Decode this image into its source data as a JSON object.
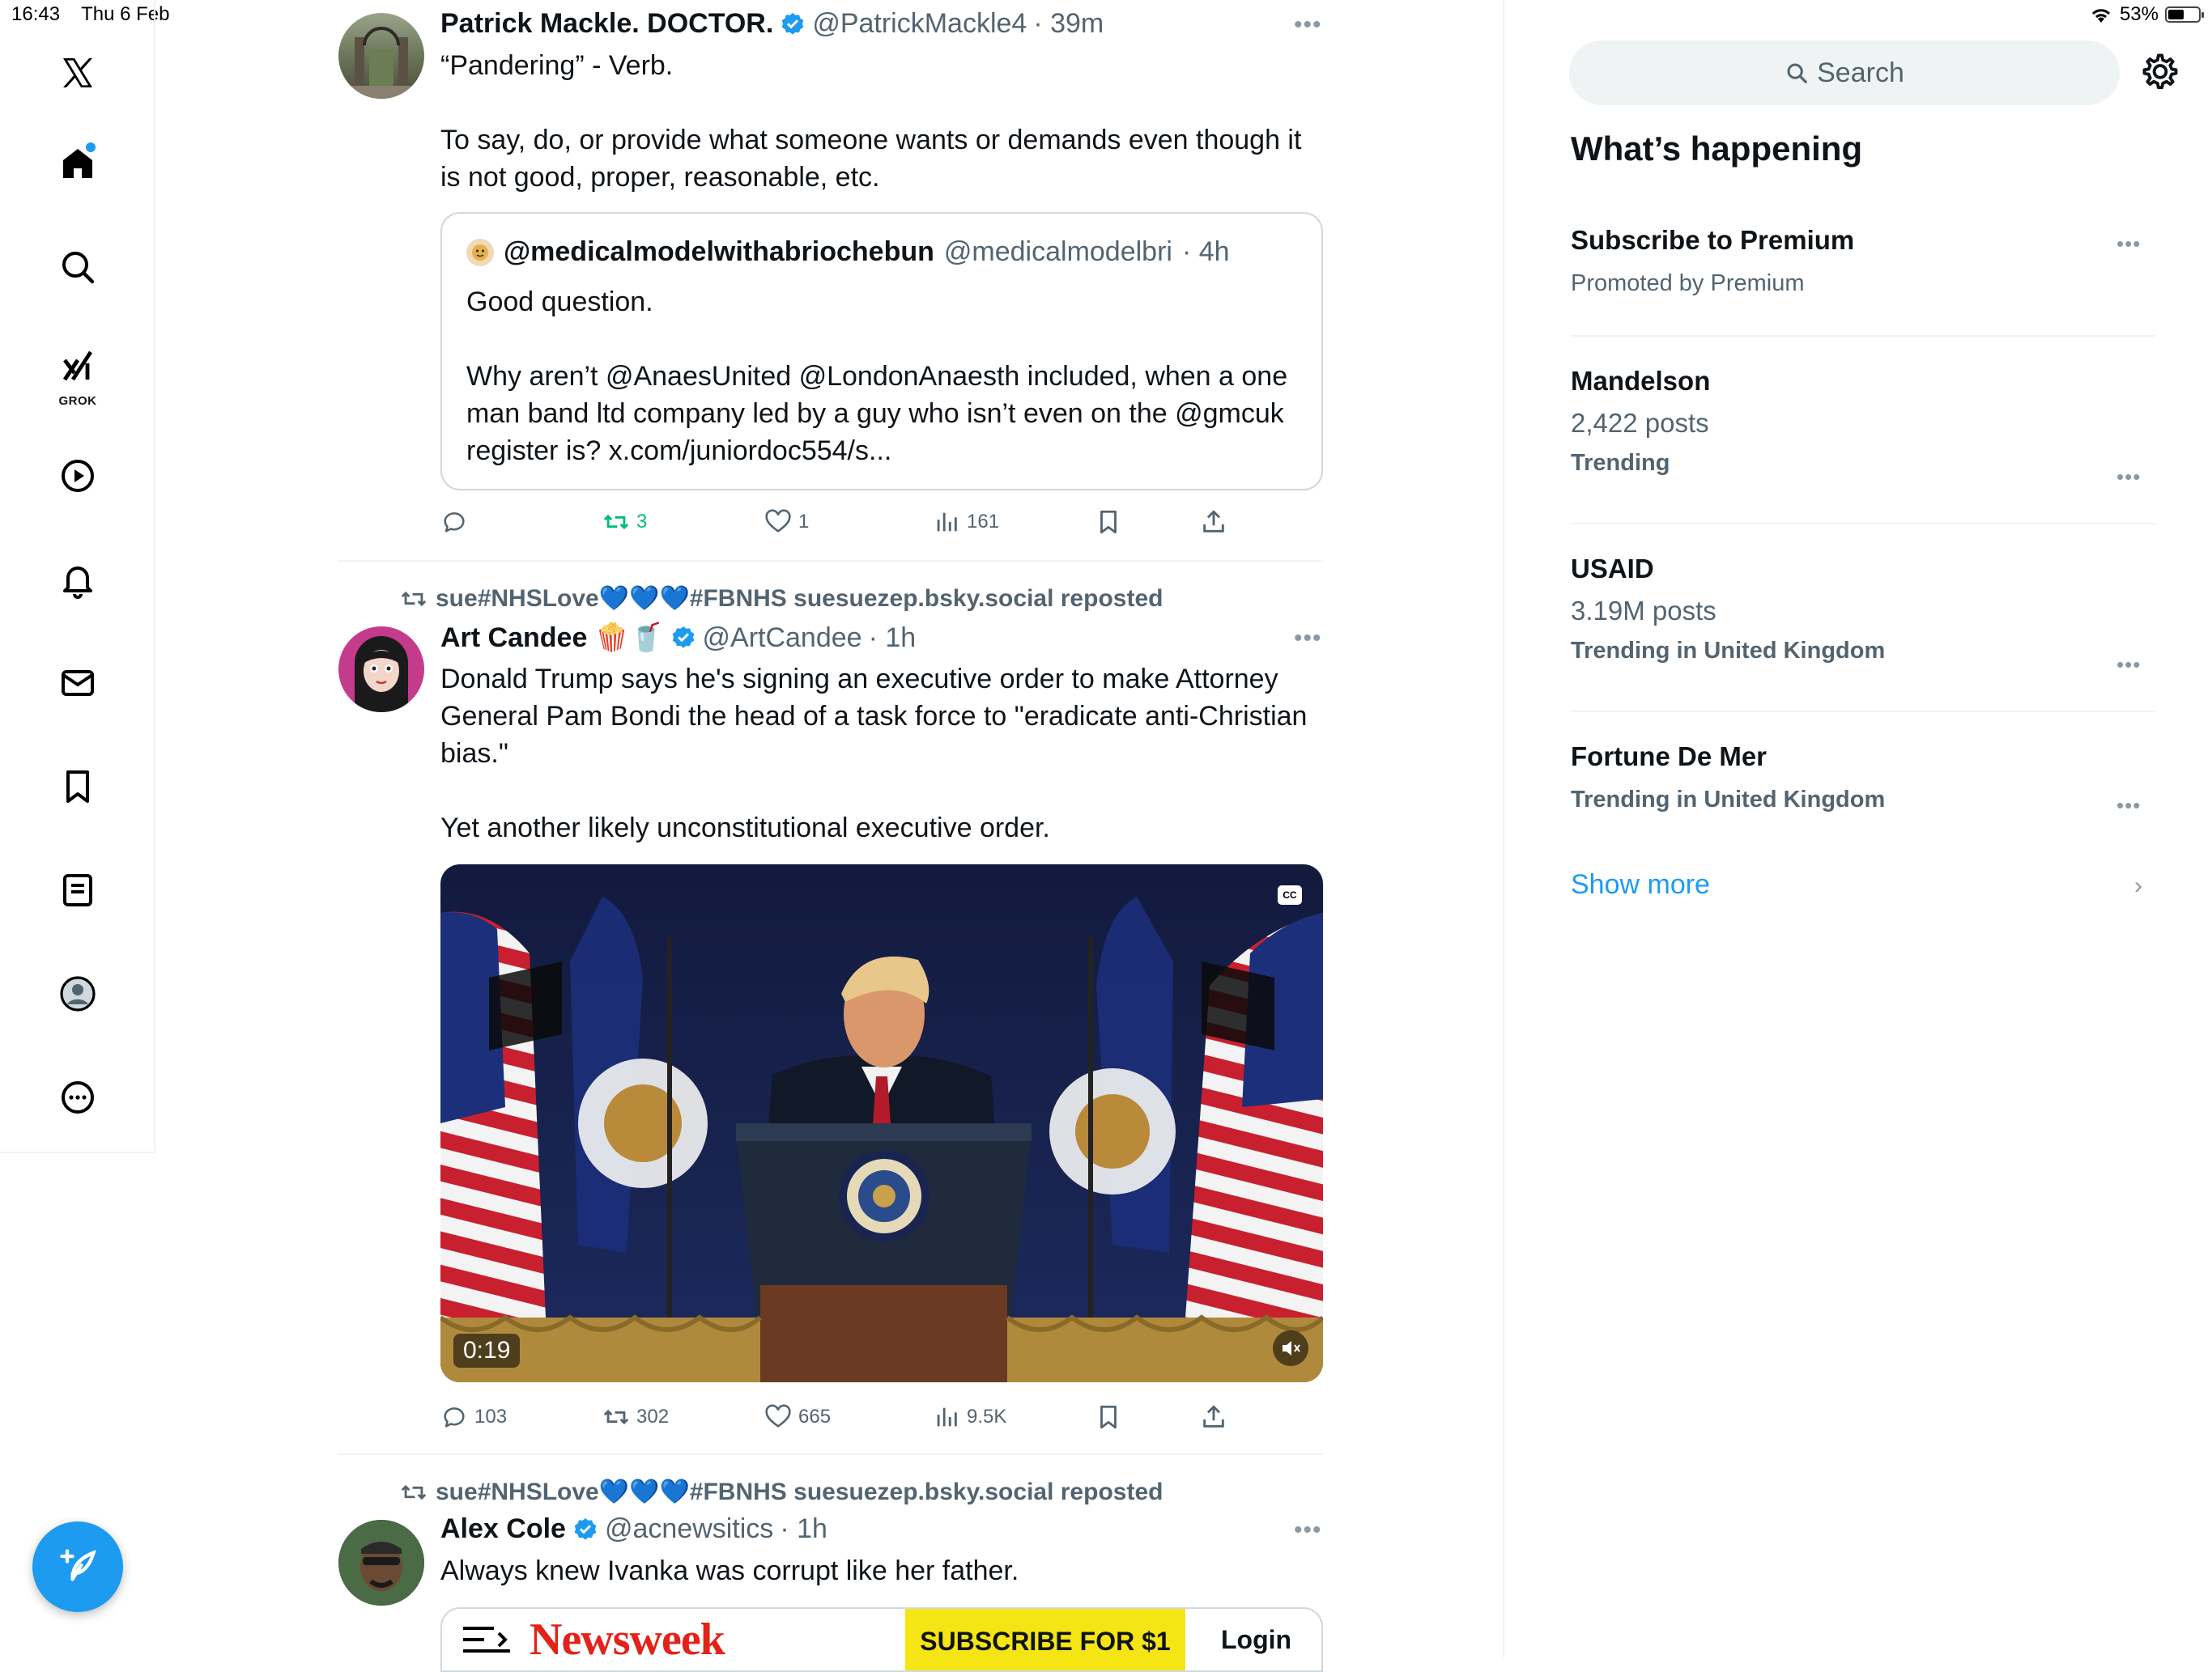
{
  "status_bar": {
    "time": "16:43",
    "date": "Thu 6 Feb",
    "battery": "53%",
    "battery_level": 0.53
  },
  "left_nav": {
    "items": [
      {
        "name": "x-logo-icon"
      },
      {
        "name": "home-icon"
      },
      {
        "name": "explore-icon"
      },
      {
        "name": "grok-icon",
        "label": "GROK"
      },
      {
        "name": "video-icon"
      },
      {
        "name": "notifications-icon"
      },
      {
        "name": "messages-icon"
      },
      {
        "name": "bookmarks-icon"
      },
      {
        "name": "lists-icon"
      },
      {
        "name": "profile-icon"
      },
      {
        "name": "more-icon"
      }
    ],
    "compose_icon": "compose-icon"
  },
  "tweets": [
    {
      "name": "Patrick Mackle. DOCTOR.",
      "handle": "@PatrickMackle4",
      "time": "· 39m",
      "text_lines": [
        "“Pandering” - Verb.",
        "To say, do, or provide what someone wants or demands even though it is not good, proper, reasonable, etc."
      ],
      "quote": {
        "name": "@medicalmodelwithabriochebun",
        "handle": "@medicalmodelbri",
        "time": "· 4h",
        "line1": "Good question.",
        "line2": "Why aren’t @AnaesUnited @LondonAnaesth included,  when a one man band ltd company led by a guy who isn’t even on the @gmcuk register is? x.com/juniordoc554/s..."
      },
      "actions": {
        "replies": "",
        "reposts": "3",
        "likes": "1",
        "views": "161"
      }
    },
    {
      "reposted_by": "sue#NHSLove💙💙💙#FBNHS suesuezep.bsky.social reposted",
      "name": "Art Candee 🍿🥤",
      "handle": "@ArtCandee",
      "time": "· 1h",
      "text1": "Donald Trump says he's signing an executive order to make Attorney General Pam Bondi the head of a task force to \"eradicate anti-Christian bias.\"",
      "text2": "Yet another likely unconstitutional executive order.",
      "video_time": "0:19",
      "video_cc": "CC",
      "actions": {
        "replies": "103",
        "reposts": "302",
        "likes": "665",
        "views": "9.5K"
      }
    },
    {
      "reposted_by": "sue#NHSLove💙💙💙#FBNHS suesuezep.bsky.social reposted",
      "name": "Alex Cole",
      "handle": "@acnewsitics",
      "time": "· 1h",
      "text": "Always knew Ivanka was corrupt like her father.",
      "card": {
        "brand": "Newsweek",
        "subscribe": "SUBSCRIBE FOR $1",
        "login": "Login"
      }
    }
  ],
  "right_panel": {
    "search_placeholder": "Search",
    "title": "What’s happening",
    "trends": [
      {
        "title": "Subscribe to Premium",
        "meta": "Promoted by Premium"
      },
      {
        "title": "Mandelson",
        "posts": "2,422 posts",
        "meta": "Trending"
      },
      {
        "title": "USAID",
        "posts": "3.19M posts",
        "meta": "Trending in United Kingdom"
      },
      {
        "title": "Fortune De Mer",
        "meta": "Trending in United Kingdom"
      }
    ],
    "show_more": "Show more"
  }
}
